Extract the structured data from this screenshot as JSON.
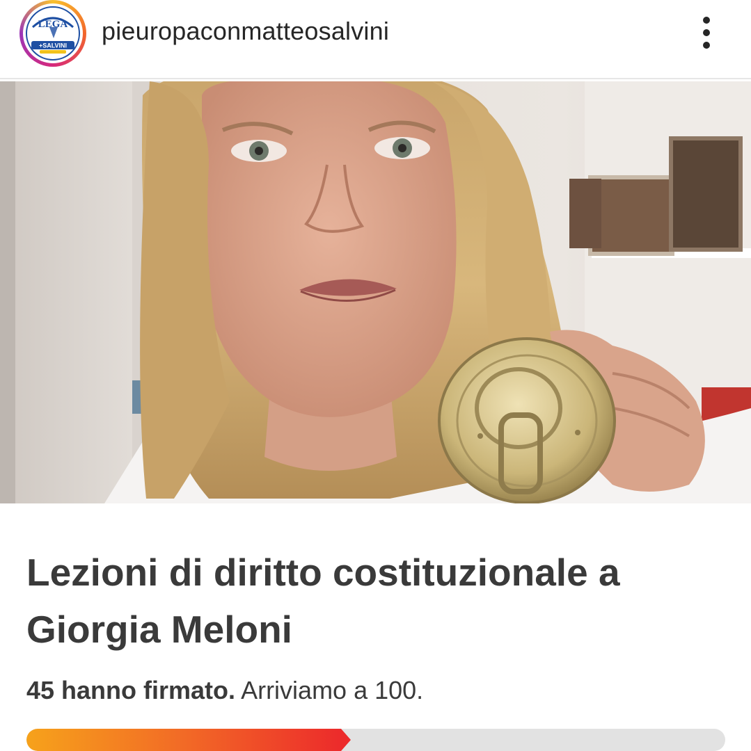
{
  "header": {
    "username": "pieuropaconmatteosalvini",
    "avatar_logo_text": "LEGA +SALVINI",
    "more_icon": "more-vertical-icon"
  },
  "photo": {
    "description_icon": "post-photo"
  },
  "petition": {
    "title": "Lezioni di diritto costituzionale a Giorgia Meloni",
    "signed_count_text": "45 hanno firmato.",
    "goal_text": " Arriviamo a 100.",
    "signed": 45,
    "goal": 100
  },
  "colors": {
    "progress_start": "#f6a21b",
    "progress_end": "#ec2b2b",
    "track": "#e2e2e2",
    "title": "#3a3a3a"
  }
}
